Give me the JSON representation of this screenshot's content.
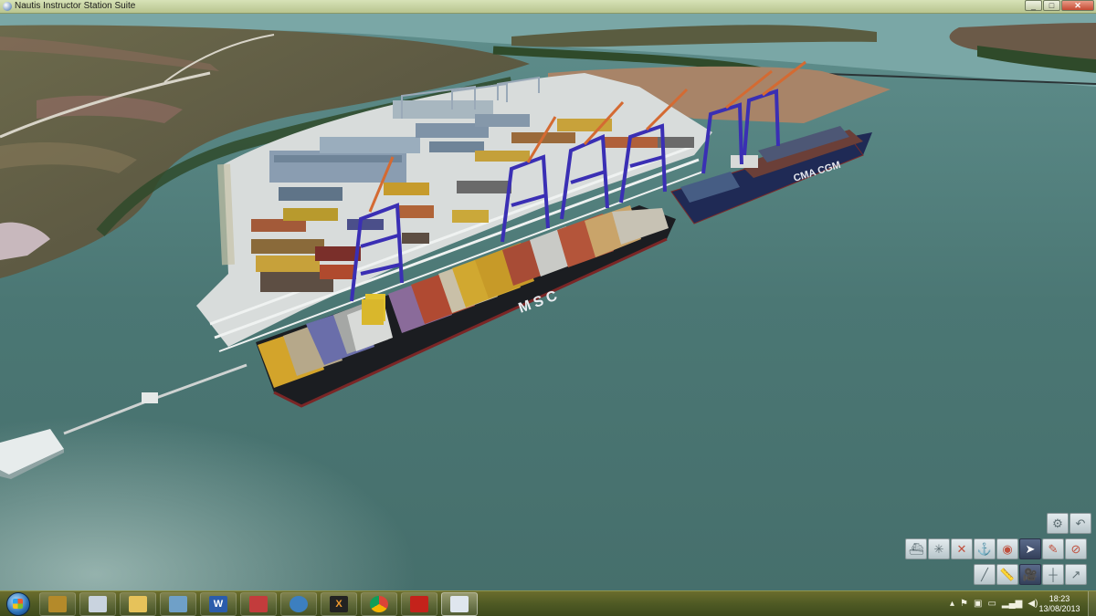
{
  "window": {
    "title": "Nautis Instructor Station Suite",
    "buttons": [
      "minimize",
      "maximize",
      "close"
    ]
  },
  "scene": {
    "description_icons": [
      "port-terminal",
      "container-ship",
      "gantry-crane"
    ],
    "ships": [
      {
        "hull_text": "MSC"
      },
      {
        "hull_text": "CMA CGM"
      }
    ],
    "colors": {
      "water": "#4e7a76",
      "quay": "#d9dcdb",
      "crane": "#3a33b0",
      "hull": "#1c1e22"
    }
  },
  "sim_toolbar": {
    "row1": [
      "camera-settings-icon",
      "undo-arrow-icon"
    ],
    "row2": [
      "ship-view-icon",
      "compass-star-icon",
      "crossed-tools-icon",
      "vessel-icon",
      "target-icon",
      "pointer-cursor-icon",
      "chart-marker-icon",
      "no-entry-icon"
    ],
    "row3": [
      "rifle-tool-icon",
      "ruler-icon",
      "camera-icon",
      "mast-icon",
      "arrow-tool-icon"
    ],
    "active": "pointer-cursor-icon"
  },
  "taskbar": {
    "pinned": [
      {
        "name": "archive-app-icon",
        "label": ""
      },
      {
        "name": "calculator-icon",
        "label": ""
      },
      {
        "name": "file-explorer-icon",
        "label": ""
      },
      {
        "name": "notes-app-icon",
        "label": ""
      },
      {
        "name": "word-icon",
        "label": "W"
      },
      {
        "name": "chart-app-icon",
        "label": ""
      },
      {
        "name": "mail-app-icon",
        "label": ""
      },
      {
        "name": "xmind-icon",
        "label": "X"
      },
      {
        "name": "chrome-icon",
        "label": ""
      },
      {
        "name": "pdf-reader-icon",
        "label": ""
      },
      {
        "name": "nautis-app-icon",
        "label": ""
      }
    ],
    "tray": {
      "time": "18:23",
      "date": "13/08/2013"
    }
  }
}
